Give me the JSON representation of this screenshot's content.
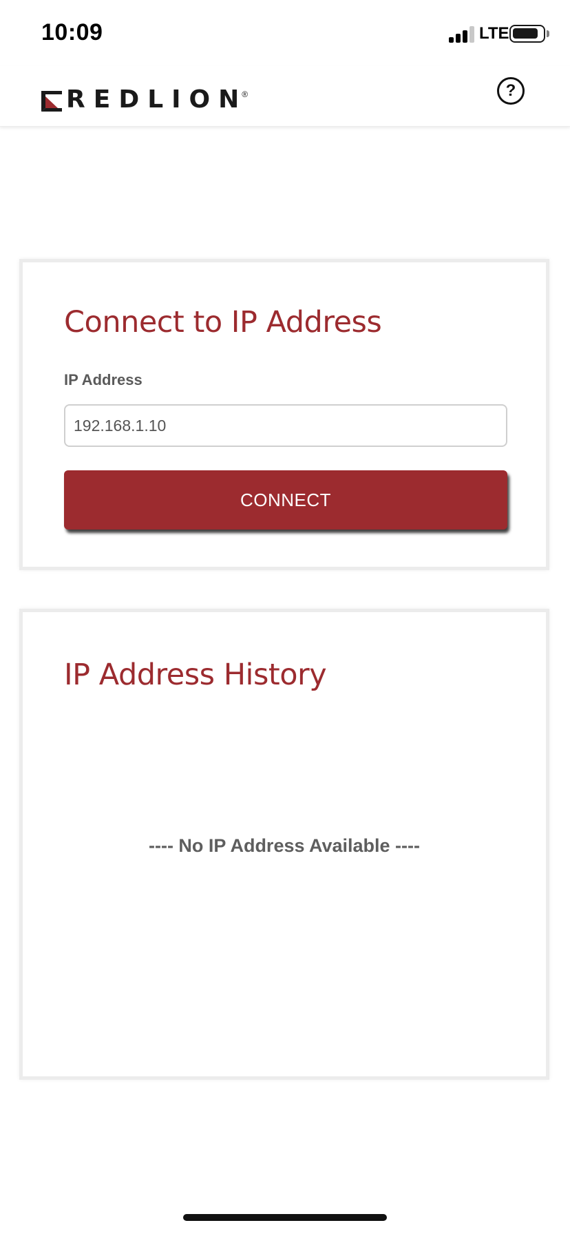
{
  "status_bar": {
    "time": "10:09",
    "network": "LTE",
    "signal_bars_filled": 3,
    "signal_bars_total": 4,
    "battery_level": 0.85
  },
  "header": {
    "logo_text": "REDLION",
    "logo_registered": "®",
    "help_icon": "question-circle-icon",
    "help_label": "?"
  },
  "connect": {
    "title": "Connect to IP Address",
    "ip_label": "IP Address",
    "ip_value": "192.168.1.10",
    "button_label": "CONNECT"
  },
  "history": {
    "title": "IP Address History",
    "empty_message": "---- No IP Address Available ----"
  },
  "colors": {
    "brand_red": "#9c2b2f",
    "text_gray": "#5a5a5a",
    "card_border": "#ececec"
  }
}
